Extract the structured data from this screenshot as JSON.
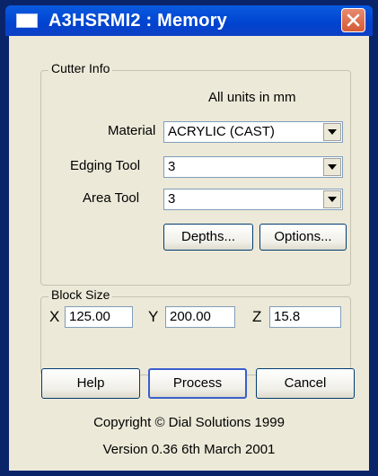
{
  "window": {
    "title": "A3HSRMI2 : Memory",
    "close_icon": "close-icon",
    "colors": {
      "titlebar": "#0043cf",
      "close": "#d55a36",
      "face": "#ece9d8"
    }
  },
  "cutter_info": {
    "group_label": "Cutter Info",
    "units_note": "All units in mm",
    "material": {
      "label": "Material",
      "value": "ACRYLIC (CAST)"
    },
    "edging_tool": {
      "label": "Edging Tool",
      "value": "3"
    },
    "area_tool": {
      "label": "Area Tool",
      "value": "3"
    },
    "depths_label": "Depths...",
    "options_label": "Options..."
  },
  "block_size": {
    "group_label": "Block Size",
    "x": {
      "label": "X",
      "value": "125.00"
    },
    "y": {
      "label": "Y",
      "value": "200.00"
    },
    "z": {
      "label": "Z",
      "value": "15.8"
    }
  },
  "actions": {
    "help_label": "Help",
    "process_label": "Process",
    "cancel_label": "Cancel"
  },
  "footer": {
    "copyright": "Copyright © Dial Solutions 1999",
    "version": "Version 0.36 6th March 2001"
  }
}
